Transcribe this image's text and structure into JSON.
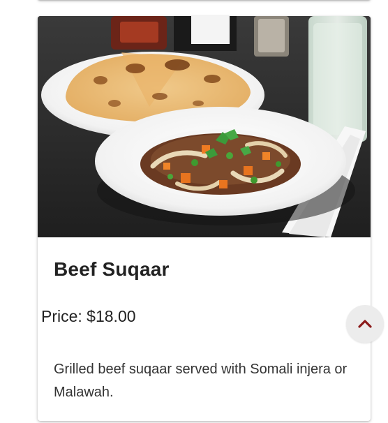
{
  "menu_item": {
    "photo_alt": "Beef Suqaar",
    "title": "Beef Suqaar",
    "price": "Price: $18.00",
    "description": "Grilled beef suqaar served with Somali injera or Malawah."
  },
  "icons": {
    "scroll_top": "chevron-up-icon"
  },
  "colors": {
    "scroll_top_chevron": "#8b1a1a",
    "scroll_top_bg": "#ececec",
    "title_text": "#222222"
  }
}
